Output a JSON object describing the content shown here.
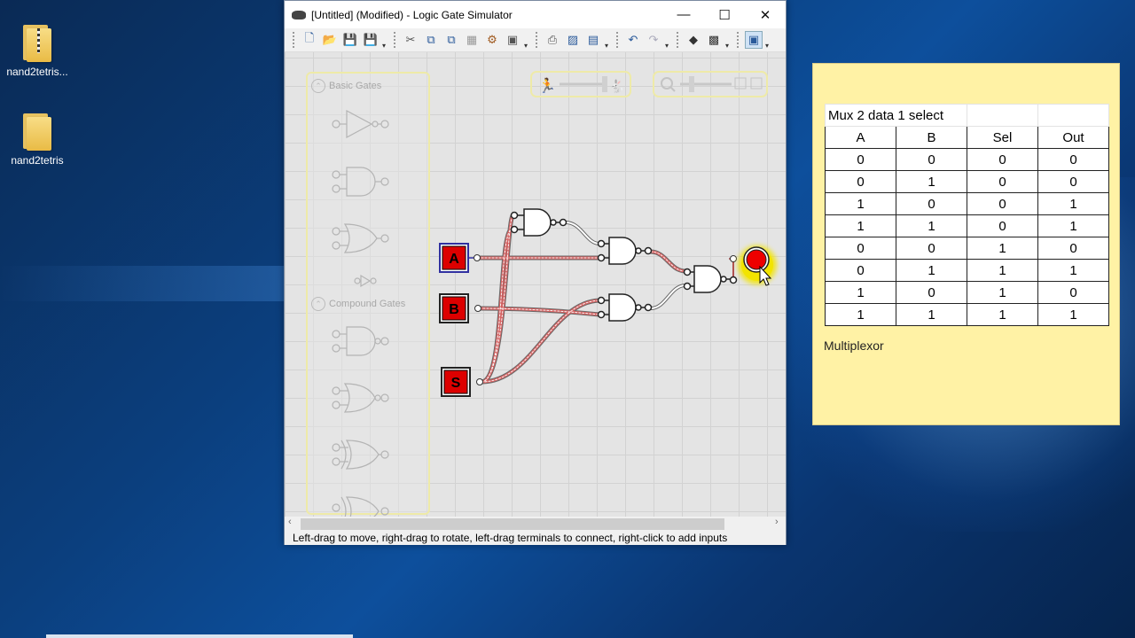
{
  "desktop": {
    "icons": [
      {
        "label": "nand2tetris...",
        "icon": "zip-folder-icon"
      },
      {
        "label": "nand2tetris",
        "icon": "folder-icon"
      }
    ]
  },
  "window": {
    "title": "[Untitled] (Modified)  - Logic Gate Simulator",
    "controls": {
      "minimize": "—",
      "maximize": "☐",
      "close": "✕"
    },
    "toolbar": [
      "new-icon",
      "open-icon",
      "save-icon",
      "save-all-icon",
      "cut-icon",
      "copy-icon",
      "paste-icon",
      "clear-icon",
      "settings-icon",
      "print-icon",
      "image-icon",
      "table-icon",
      "undo-icon",
      "redo-icon",
      "run-icon",
      "plugin-icon",
      "view-icon"
    ],
    "palette": {
      "basic_gates": "Basic Gates",
      "compound_gates": "Compound Gates"
    },
    "inputs": [
      {
        "label": "A"
      },
      {
        "label": "B"
      },
      {
        "label": "S"
      }
    ],
    "status": "Left-drag to move, right-drag to rotate, left-drag terminals to connect, right-click to add inputs"
  },
  "note": {
    "caption": "Mux 2 data 1 select",
    "headers": [
      "A",
      "B",
      "Sel",
      "Out"
    ],
    "rows": [
      [
        "0",
        "0",
        "0",
        "0"
      ],
      [
        "0",
        "1",
        "0",
        "0"
      ],
      [
        "1",
        "0",
        "0",
        "1"
      ],
      [
        "1",
        "1",
        "0",
        "1"
      ],
      [
        "0",
        "0",
        "1",
        "0"
      ],
      [
        "0",
        "1",
        "1",
        "1"
      ],
      [
        "1",
        "0",
        "1",
        "0"
      ],
      [
        "1",
        "1",
        "1",
        "1"
      ]
    ],
    "label": "Multiplexor"
  },
  "colors": {
    "input_fill": "#dd0000",
    "output_on": "#ee0000",
    "highlight": "#f2e400",
    "wire_active": "#c8504a"
  }
}
